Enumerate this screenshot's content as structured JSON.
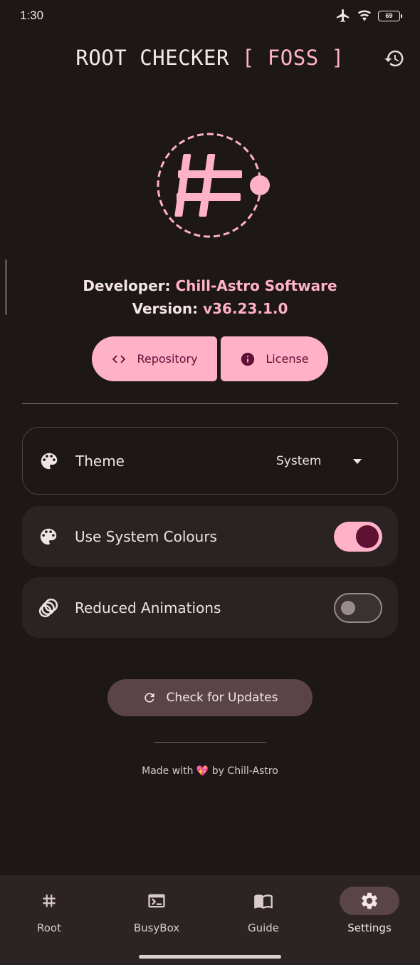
{
  "status_bar": {
    "time": "1:30",
    "battery": "69",
    "icons": [
      "airplane-icon",
      "wifi-icon",
      "battery-icon"
    ]
  },
  "header": {
    "title_main": "ROOT CHECKER",
    "title_accent": "[ FOSS ]",
    "history_icon": "history-icon"
  },
  "about": {
    "developer_label": "Developer:",
    "developer_value": "Chill-Astro Software",
    "version_label": "Version:",
    "version_value": "v36.23.1.0"
  },
  "actions": {
    "repository_label": "Repository",
    "license_label": "License"
  },
  "settings": {
    "theme": {
      "label": "Theme",
      "value": "System"
    },
    "system_colours": {
      "label": "Use System Colours",
      "enabled": true
    },
    "reduced_animations": {
      "label": "Reduced Animations",
      "enabled": false
    }
  },
  "update_button": {
    "label": "Check for Updates"
  },
  "footer": {
    "prefix": "Made with",
    "emoji": "💖",
    "suffix": "by Chill-Astro"
  },
  "bottom_nav": {
    "items": [
      {
        "label": "Root",
        "icon": "hash-icon",
        "active": false
      },
      {
        "label": "BusyBox",
        "icon": "terminal-icon",
        "active": false
      },
      {
        "label": "Guide",
        "icon": "book-icon",
        "active": false
      },
      {
        "label": "Settings",
        "icon": "gear-icon",
        "active": true
      }
    ]
  },
  "colors": {
    "background": "#1e1718",
    "accent": "#ffb1c8",
    "on_accent": "#5e1133",
    "surface": "#2a2223",
    "active_indicator": "#5a4448"
  }
}
